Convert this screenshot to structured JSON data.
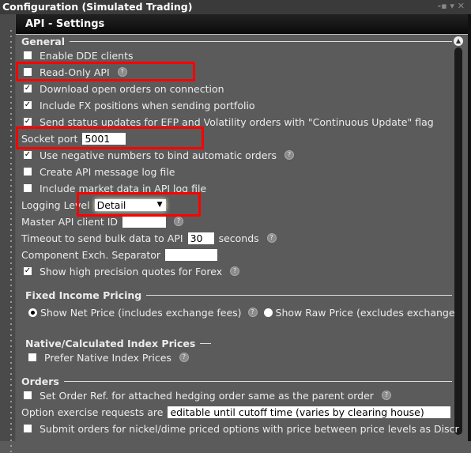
{
  "window": {
    "title": "Configuration (Simulated Trading)",
    "controls": "-▪ ▾  ✕"
  },
  "header": {
    "title": "API - Settings"
  },
  "sections": {
    "general": "General",
    "fixed_income": "Fixed Income Pricing",
    "native": "Native/Calculated Index Prices",
    "orders": "Orders"
  },
  "general": {
    "enable_dde": {
      "label": "Enable DDE clients",
      "checked": false
    },
    "read_only": {
      "label": "Read-Only API",
      "checked": false
    },
    "download_orders": {
      "label": "Download open orders on connection",
      "checked": true
    },
    "include_fx": {
      "label": "Include FX positions when sending portfolio",
      "checked": true
    },
    "send_status": {
      "label": "Send status updates for EFP and Volatility orders with \"Continuous Update\" flag",
      "checked": true
    },
    "socket_port": {
      "label": "Socket port",
      "value": "5001"
    },
    "negative_numbers": {
      "label": "Use negative numbers to bind automatic orders",
      "checked": true
    },
    "create_log": {
      "label": "Create API message log file",
      "checked": false
    },
    "include_market_data": {
      "label": "Include market data in API log file",
      "checked": false
    },
    "logging_level": {
      "label": "Logging Level",
      "value": "Detail"
    },
    "master_client_id": {
      "label": "Master API client ID",
      "value": ""
    },
    "timeout": {
      "label": "Timeout to send bulk data to API",
      "value": "30",
      "unit": "seconds"
    },
    "separator": {
      "label": "Component Exch. Separator",
      "value": ""
    },
    "high_precision": {
      "label": "Show high precision quotes for Forex",
      "checked": true
    }
  },
  "fixed_income": {
    "net": "Show Net Price (includes exchange fees)",
    "raw": "Show Raw Price (excludes exchange",
    "selected": "net"
  },
  "native": {
    "prefer": {
      "label": "Prefer Native Index Prices",
      "checked": false
    }
  },
  "orders": {
    "set_order_ref": {
      "label": "Set Order Ref. for attached hedging order same as the parent order",
      "checked": false
    },
    "option_exercise": {
      "label": "Option exercise requests are",
      "value": "editable until cutoff time (varies by clearing house)"
    },
    "submit_nickel": {
      "label": "Submit orders for nickel/dime priced options with price between price levels as Discr",
      "checked": false
    }
  },
  "colors": {
    "highlight": "#ff0000",
    "background": "#5b5b5b"
  }
}
